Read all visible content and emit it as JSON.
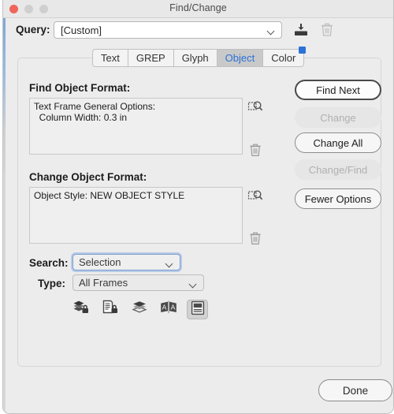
{
  "window": {
    "title": "Find/Change",
    "traffic_lights": [
      "close",
      "minimize",
      "zoom"
    ]
  },
  "query": {
    "label": "Query:",
    "value": "[Custom]",
    "placeholder": "[Custom]",
    "save_icon": "save-query-icon",
    "delete_icon": "delete-query-icon"
  },
  "tabs": [
    {
      "label": "Text",
      "selected": false
    },
    {
      "label": "GREP",
      "selected": false
    },
    {
      "label": "Glyph",
      "selected": false
    },
    {
      "label": "Object",
      "selected": true
    },
    {
      "label": "Color",
      "selected": false,
      "badge": true
    }
  ],
  "find_format": {
    "label": "Find Object Format:",
    "lines": [
      "Text Frame General Options:",
      "  Column Width: 0.3 in"
    ],
    "specify_icon": "specify-attributes-icon",
    "clear_icon": "trash-icon"
  },
  "change_format": {
    "label": "Change Object Format:",
    "lines": [
      "Object Style: NEW OBJECT STYLE"
    ],
    "specify_icon": "specify-attributes-icon",
    "clear_icon": "trash-icon"
  },
  "search": {
    "label": "Search:",
    "value": "Selection"
  },
  "type": {
    "label": "Type:",
    "value": "All Frames"
  },
  "toggles": [
    {
      "name": "include-locked-layers-icon",
      "active": false
    },
    {
      "name": "include-locked-stories-icon",
      "active": false
    },
    {
      "name": "include-hidden-layers-icon",
      "active": false
    },
    {
      "name": "case-sensitive-icon",
      "active": false
    },
    {
      "name": "include-master-pages-icon",
      "active": true
    }
  ],
  "buttons": {
    "find_next": "Find Next",
    "change": "Change",
    "change_all": "Change All",
    "change_find": "Change/Find",
    "fewer_options": "Fewer Options",
    "done": "Done"
  },
  "colors": {
    "accent": "#2b72d8",
    "close_light": "#f0655a",
    "window_bg": "#ececec",
    "tab_selected_bg": "#c9c9c9"
  }
}
